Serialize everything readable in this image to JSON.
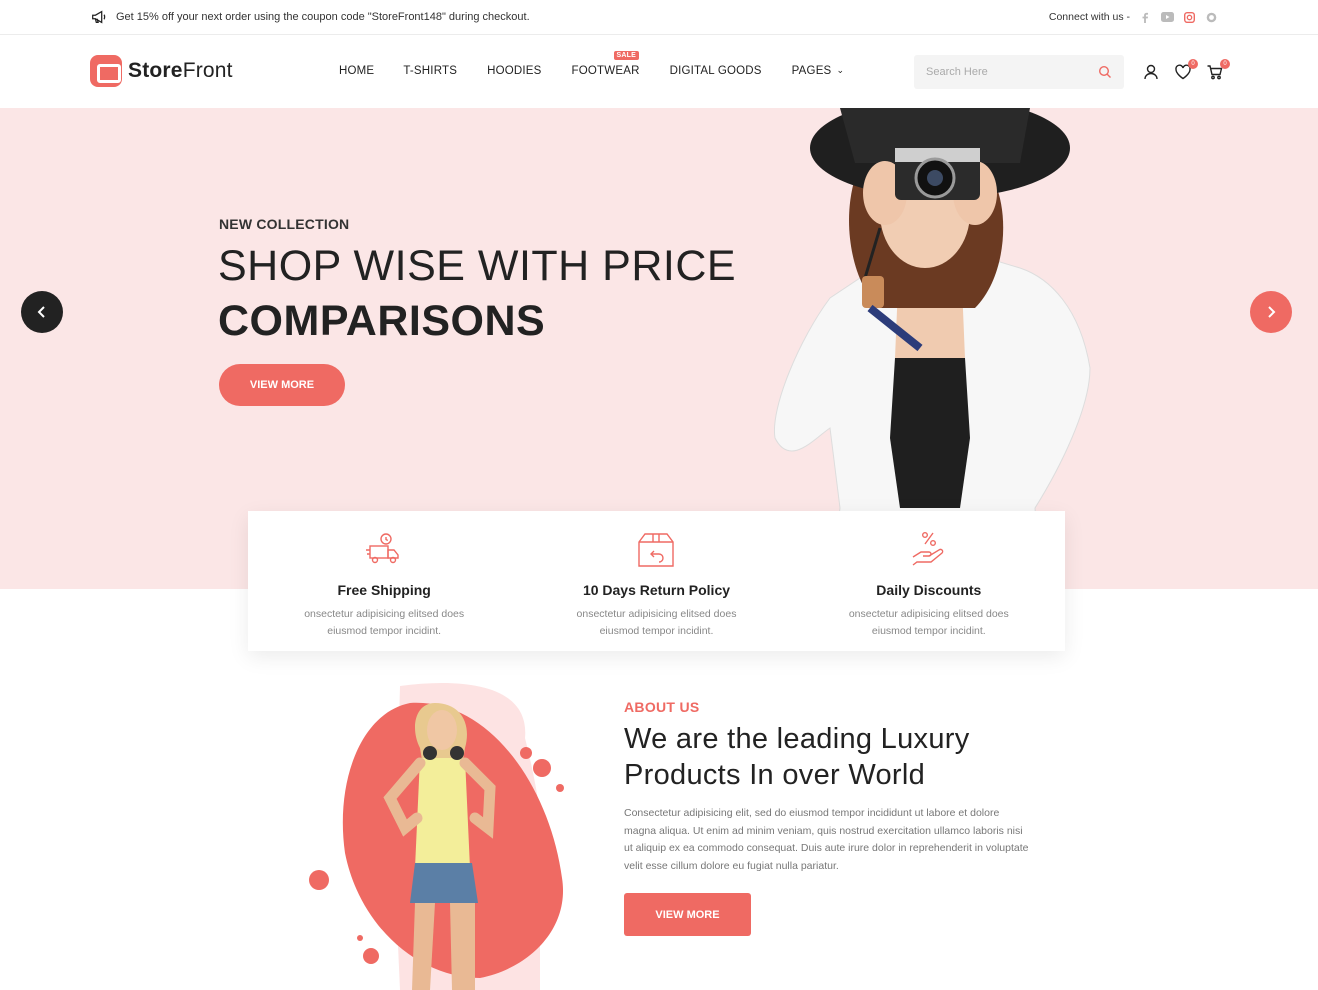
{
  "topbar": {
    "promo_icon": "megaphone-icon",
    "promo_text": "Get 15% off your next order using the coupon code \"StoreFront148\" during checkout.",
    "connect_label": "Connect with us -",
    "social": [
      "facebook-icon",
      "youtube-icon",
      "instagram-icon",
      "whatsapp-icon"
    ]
  },
  "header": {
    "logo_bold": "Store",
    "logo_light": "Front",
    "nav": [
      {
        "label": "HOME"
      },
      {
        "label": "T-SHIRTS"
      },
      {
        "label": "HOODIES"
      },
      {
        "label": "FOOTWEAR",
        "badge": "SALE"
      },
      {
        "label": "DIGITAL GOODS"
      },
      {
        "label": "PAGES"
      }
    ],
    "search_placeholder": "Search Here",
    "wishlist_count": "0",
    "cart_count": "0"
  },
  "hero": {
    "eyebrow": "NEW COLLECTION",
    "headline_line1": "SHOP WISE WITH PRICE",
    "headline_line2": "COMPARISONS",
    "button_label": "VIEW MORE"
  },
  "features": [
    {
      "title": "Free Shipping",
      "description": "onsectetur adipisicing elitsed does eiusmod tempor incidint.",
      "icon": "delivery-truck-icon"
    },
    {
      "title": "10 Days Return Policy",
      "description": "onsectetur adipisicing elitsed does eiusmod tempor incidint.",
      "icon": "return-box-icon"
    },
    {
      "title": "Daily Discounts",
      "description": "onsectetur adipisicing elitsed does eiusmod tempor incidint.",
      "icon": "discount-hand-icon"
    }
  ],
  "about": {
    "label": "ABOUT US",
    "title": "We are the leading Luxury Products In over World",
    "text": "Consectetur adipisicing elit, sed do eiusmod tempor incididunt ut labore et dolore magna aliqua. Ut enim ad minim veniam, quis nostrud exercitation ullamco laboris nisi ut aliquip ex ea commodo consequat. Duis aute irure dolor in reprehenderit in voluptate velit esse cillum dolore eu fugiat nulla pariatur.",
    "button_label": "VIEW MORE"
  },
  "colors": {
    "accent": "#ef6a63",
    "hero_bg": "#fbe6e6",
    "dark": "#222222"
  }
}
